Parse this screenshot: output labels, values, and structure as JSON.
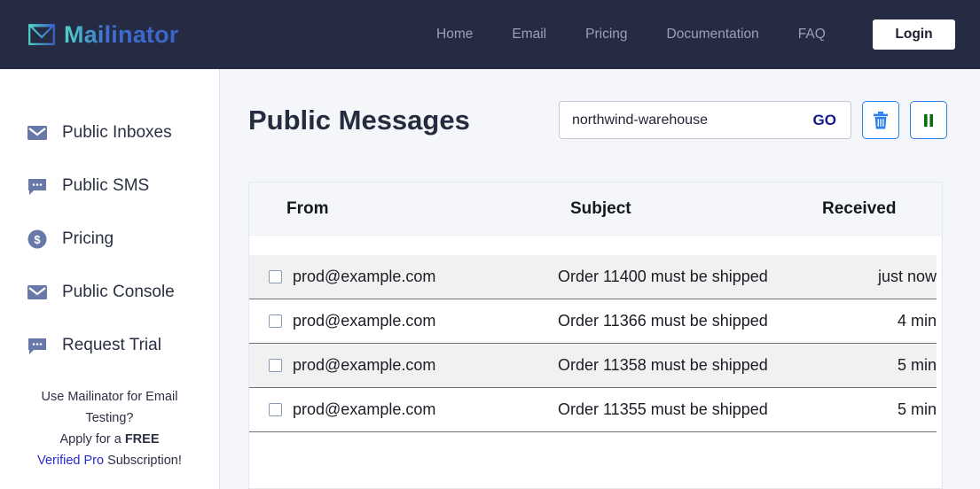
{
  "header": {
    "brand": "Mailinator",
    "brand_icon": "envelope-logo-icon",
    "nav": [
      {
        "label": "Home"
      },
      {
        "label": "Email"
      },
      {
        "label": "Pricing"
      },
      {
        "label": "Documentation"
      },
      {
        "label": "FAQ"
      }
    ],
    "login_label": "Login",
    "bar_color": "#252b42"
  },
  "sidebar": {
    "items": [
      {
        "label": "Public Inboxes",
        "icon": "envelope-icon"
      },
      {
        "label": "Public SMS",
        "icon": "chat-bubble-icon"
      },
      {
        "label": "Pricing",
        "icon": "dollar-circle-icon"
      },
      {
        "label": "Public Console",
        "icon": "envelope-icon"
      },
      {
        "label": "Request Trial",
        "icon": "chat-bubble-icon"
      }
    ],
    "promo": {
      "line1": "Use Mailinator for Email",
      "line2": "Testing?",
      "line3_prefix": "Apply for a ",
      "line3_strong": "FREE",
      "line4_link": "Verified Pro",
      "line4_suffix": " Subscription!",
      "link_color": "#2a2ad0"
    }
  },
  "main": {
    "page_title": "Public Messages",
    "search": {
      "value": "northwind-warehouse",
      "placeholder": "",
      "go_label": "GO",
      "go_color": "#141a8c"
    },
    "buttons": {
      "delete_icon": "trash-icon",
      "delete_color": "#2a7ff0",
      "pause_icon": "pause-icon",
      "pause_color": "#0a6b10"
    },
    "table": {
      "columns": [
        "From",
        "Subject",
        "Received"
      ],
      "rows": [
        {
          "from": "prod@example.com",
          "subject": "Order 11400 must be shipped",
          "received": "just now",
          "checked": false,
          "highlighted": true
        },
        {
          "from": "prod@example.com",
          "subject": "Order 11366 must be shipped",
          "received": "4 min",
          "checked": false,
          "highlighted": false
        },
        {
          "from": "prod@example.com",
          "subject": "Order 11358 must be shipped",
          "received": "5 min",
          "checked": false,
          "highlighted": true
        },
        {
          "from": "prod@example.com",
          "subject": "Order 11355 must be shipped",
          "received": "5 min",
          "checked": false,
          "highlighted": false
        }
      ]
    }
  }
}
